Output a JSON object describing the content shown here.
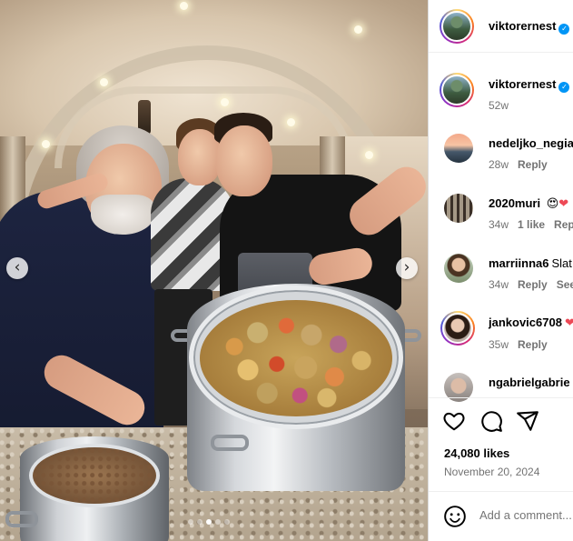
{
  "post": {
    "image_alt": "",
    "carousel": {
      "count": 5,
      "active": 2
    }
  },
  "header": {
    "username": "viktorernest",
    "verified": true
  },
  "caption": {
    "username": "viktorernest",
    "verified": true,
    "time": "52w"
  },
  "comments": [
    {
      "username": "nedeljko_negia",
      "text": "",
      "time": "28w",
      "likes": "",
      "reply": "Reply",
      "avatar": "sunset"
    },
    {
      "username": "2020muri",
      "text": "❤",
      "time": "34w",
      "likes": "1 like",
      "reply": "Rep",
      "avatar": "colosseum",
      "emoji": "😍"
    },
    {
      "username": "marriinna6",
      "text": "Slat",
      "time": "34w",
      "likes": "",
      "reply": "Reply",
      "extra": "See",
      "avatar": "woman"
    },
    {
      "username": "jankovic6708",
      "text": "",
      "time": "35w",
      "likes": "",
      "reply": "Reply",
      "avatar": "woman-story"
    },
    {
      "username": "ngabrielgabrie",
      "text": "",
      "time": "",
      "likes": "",
      "reply": "",
      "avatar": "face"
    }
  ],
  "comment_emoji_0": "🤩",
  "comment_emoji_heart": "❤",
  "actions": {
    "like_icon": "heart-icon",
    "comment_icon": "comment-icon",
    "share_icon": "share-icon"
  },
  "likes": "24,080 likes",
  "date": "November 20, 2024",
  "comment_input": {
    "placeholder": "Add a comment..."
  },
  "colors": {
    "accent": "#0095f6",
    "muted": "#737373",
    "border": "#dbdbdb"
  }
}
